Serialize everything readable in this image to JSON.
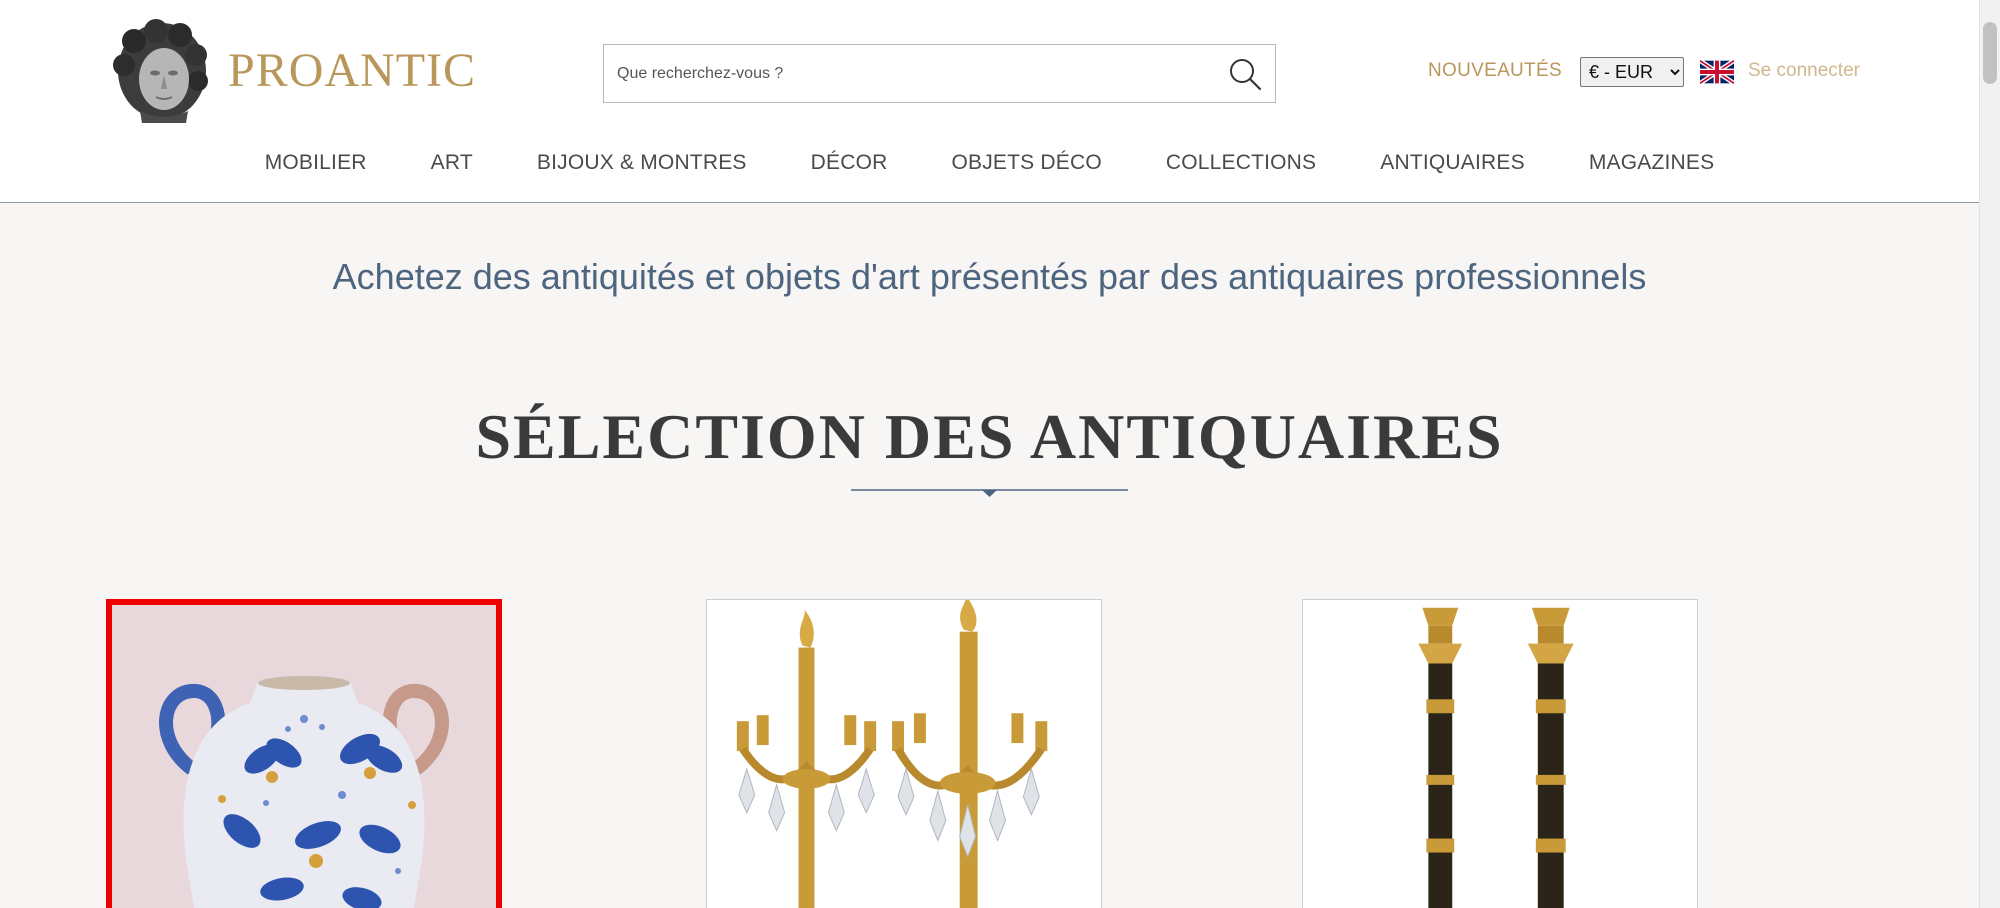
{
  "header": {
    "logo_text": "PROANTIC",
    "search_placeholder": "Que recherchez-vous ?",
    "nouveautes": "NOUVEAUTÉS",
    "currency": "€ - EUR",
    "language_flag": "uk-flag-icon",
    "login": "Se connecter"
  },
  "nav": {
    "items": [
      "MOBILIER",
      "ART",
      "BIJOUX & MONTRES",
      "DÉCOR",
      "OBJETS DÉCO",
      "COLLECTIONS",
      "ANTIQUAIRES",
      "MAGAZINES"
    ]
  },
  "main": {
    "tagline": "Achetez des antiquités et objets d'art présentés par des antiquaires professionnels",
    "section_title": "SÉLECTION DES ANTIQUAIRES"
  },
  "products": [
    {
      "image": "blue-floral-faience-vase-image",
      "selected": true
    },
    {
      "image": "gilt-bronze-crystal-candelabra-pair-image",
      "selected": false
    },
    {
      "image": "bronze-ormolu-candlesticks-pair-image",
      "selected": false
    }
  ],
  "colors": {
    "gold": "#b9975b",
    "tagline_blue": "#4e6580",
    "selection_red": "#ee0000",
    "page_background": "#f7f6f4"
  }
}
